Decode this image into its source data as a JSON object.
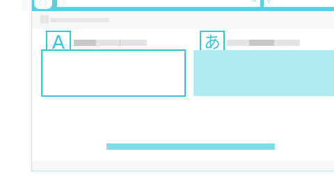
{
  "browser": {
    "nav_icon": "back-forward-icon",
    "nav_glyph": "〈 〉",
    "url_go_icon": "arrow-right-icon",
    "url_go_glyph": "→",
    "search_icon": "search-icon",
    "search_glyph": "⚲"
  },
  "translator": {
    "source_language_letter": "A",
    "target_language_letter": "あ",
    "translate_button_label": ""
  },
  "colors": {
    "accent": "#35c6dc",
    "titlebar": "#56d1e2",
    "result_background": "#b3ebf3",
    "placeholder_gray": "#e3e3e3"
  }
}
